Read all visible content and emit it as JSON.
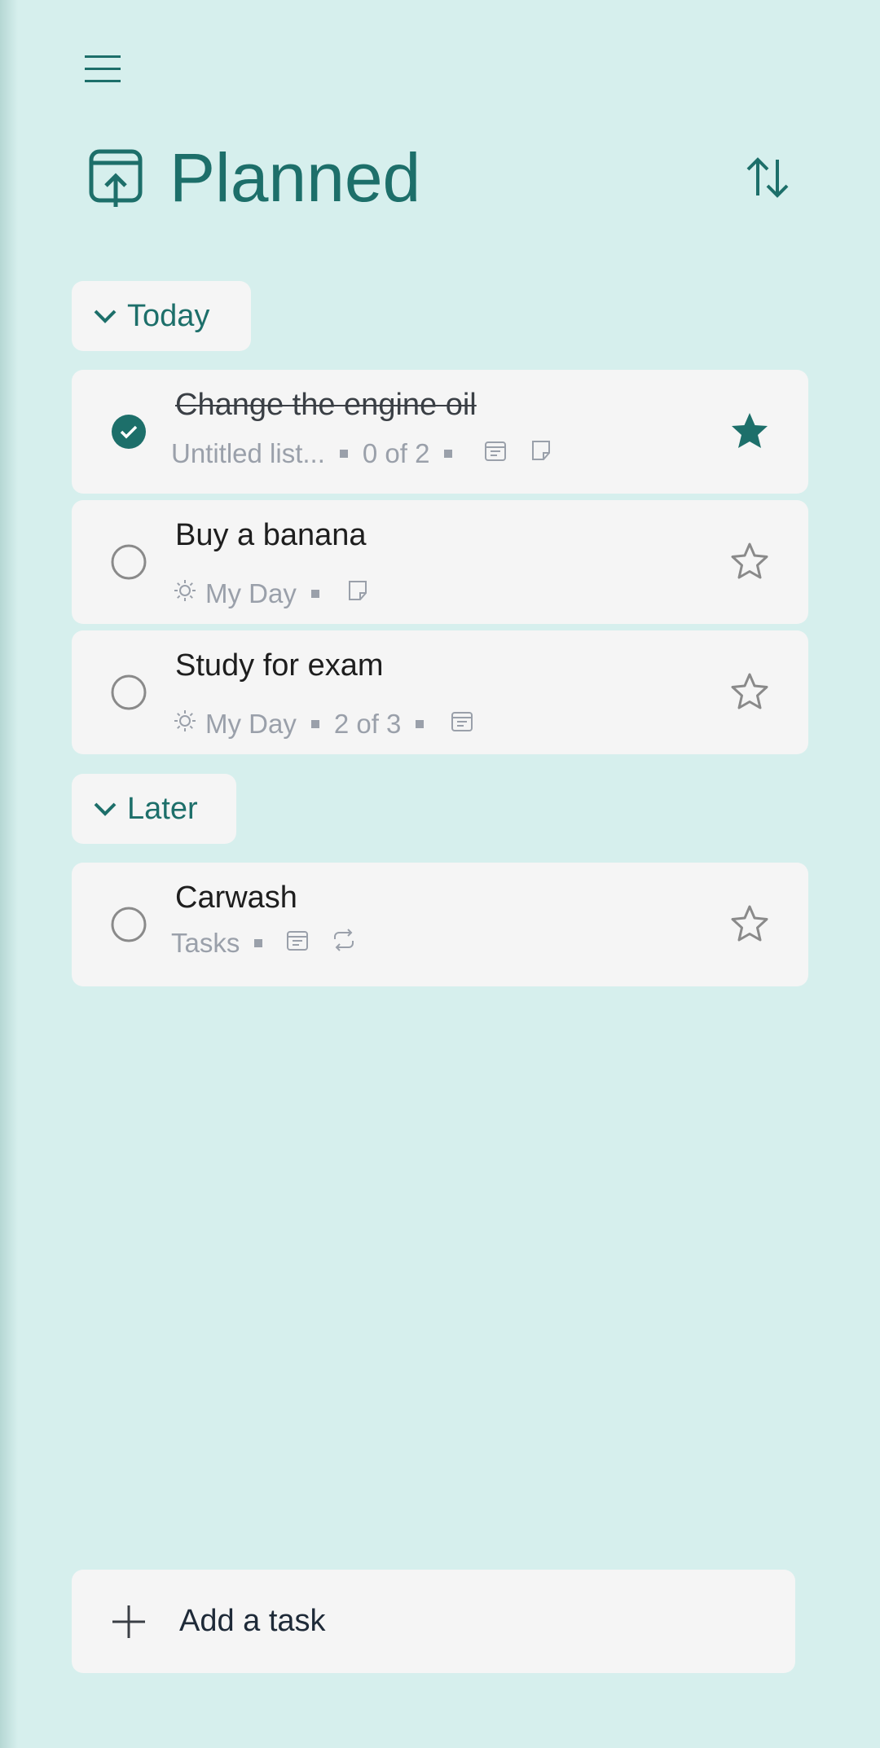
{
  "header": {
    "title": "Planned",
    "menu_icon": "hamburger-menu-icon",
    "list_icon": "planned-list-icon",
    "sort_icon": "sort-arrows-icon"
  },
  "colors": {
    "background": "#d6efed",
    "accent": "#1d6f6a",
    "card": "#f5f5f5",
    "meta_text": "#9aa0aa"
  },
  "groups": [
    {
      "label": "Today",
      "tasks": [
        {
          "title": "Change the engine oil",
          "completed": true,
          "starred": true,
          "list_name": "Untitled list...",
          "steps": "0 of 2"
        },
        {
          "title": "Buy a banana",
          "completed": false,
          "starred": false,
          "list_name": "My Day"
        },
        {
          "title": "Study for exam",
          "completed": false,
          "starred": false,
          "list_name": "My Day",
          "steps": "2 of 3"
        }
      ]
    },
    {
      "label": "Later",
      "tasks": [
        {
          "title": "Carwash",
          "completed": false,
          "starred": false,
          "list_name": "Tasks"
        }
      ]
    }
  ],
  "add_task": {
    "label": "Add a task"
  }
}
